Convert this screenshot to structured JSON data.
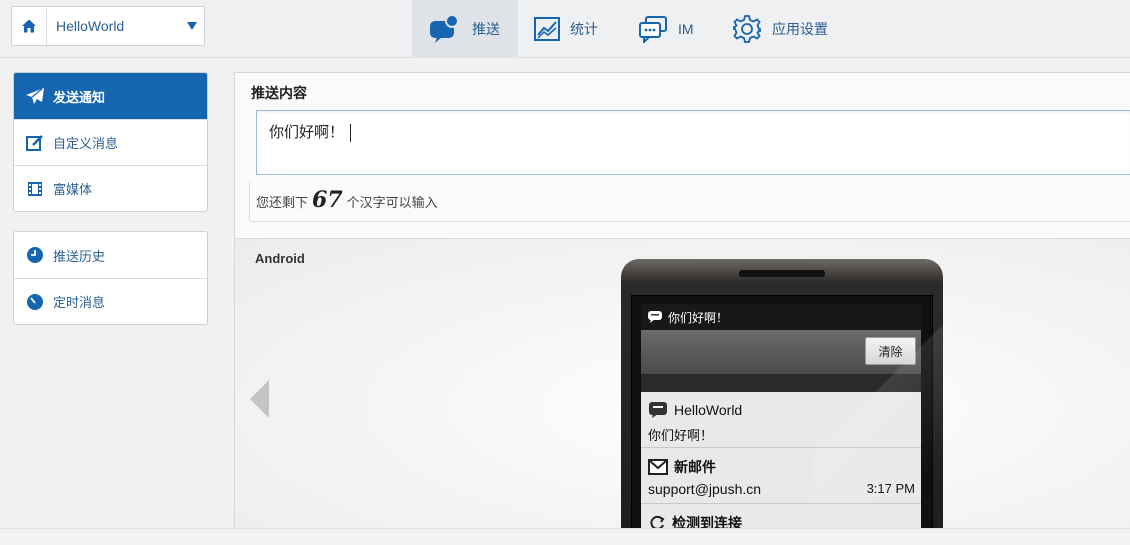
{
  "app_selector": {
    "name": "HelloWorld"
  },
  "nav": {
    "push": "推送",
    "stats": "统计",
    "im": "IM",
    "settings": "应用设置"
  },
  "sidebar": {
    "group1": [
      {
        "label": "发送通知"
      },
      {
        "label": "自定义消息"
      },
      {
        "label": "富媒体"
      }
    ],
    "group2": [
      {
        "label": "推送历史"
      },
      {
        "label": "定时消息"
      }
    ]
  },
  "push": {
    "title": "推送内容",
    "content": "你们好啊！",
    "remaining_prefix": "您还剩下",
    "remaining_count": "67",
    "remaining_suffix": "个汉字可以输入"
  },
  "preview": {
    "platform": "Android",
    "status_text": "你们好啊！",
    "clear_label": "清除",
    "notifications": [
      {
        "title": "HelloWorld",
        "body": "你们好啊！",
        "icon": "chat-bubble-icon"
      },
      {
        "title": "新邮件",
        "body": "support@jpush.cn",
        "time": "3:17 PM",
        "icon": "gmail-icon"
      },
      {
        "title": "检测到连接",
        "icon": "sync-icon"
      }
    ]
  },
  "colors": {
    "accent": "#1565b0",
    "link": "#2a5f93"
  }
}
